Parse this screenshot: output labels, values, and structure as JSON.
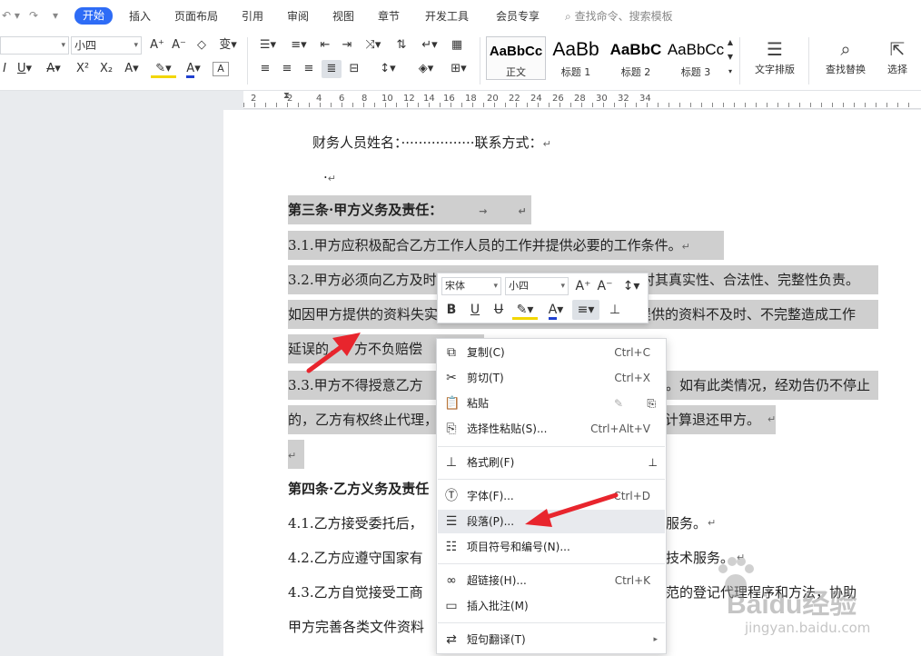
{
  "ribbon_tabs": {
    "home": "开始",
    "insert": "插入",
    "layout": "页面布局",
    "references": "引用",
    "review": "审阅",
    "view": "视图",
    "section": "章节",
    "developer": "开发工具",
    "member": "会员专享",
    "search": "查找命令、搜索模板"
  },
  "ribbon": {
    "font_size": "小四",
    "styles": [
      {
        "sample": "AaBbCc",
        "name": "正文"
      },
      {
        "sample": "AaBb",
        "name": "标题 1"
      },
      {
        "sample": "AaBbC",
        "name": "标题 2"
      },
      {
        "sample": "AaBbCc",
        "name": "标题 3"
      }
    ],
    "layout_btn": "文字排版",
    "find_replace_btn": "查找替换",
    "select_btn": "选择"
  },
  "ruler_labels": [
    "2",
    "2",
    "4",
    "6",
    "8",
    "10",
    "12",
    "14",
    "16",
    "18",
    "20",
    "22",
    "24",
    "26",
    "28",
    "30",
    "32",
    "34"
  ],
  "doc": {
    "line1": "财务人员姓名：·················联系方式：",
    "line2": "·",
    "heading3": "第三条·甲方义务及责任：",
    "p31": "3.1.甲方应积极配合乙方工作人员的工作并提供必要的工作条件。",
    "p32a": "3.2.甲方必须向乙方及时",
    "p32a_end": "对其真实性、合法性、完整性负责。",
    "p32b_start": "如因甲方提供的资料失实",
    "p32b_end": "提供的资料不及时、不完整造成工作",
    "p32c_start": "延误的，",
    "p32c_mid": "方不负赔偿",
    "p33a_start": "3.3.甲方不得授意乙方",
    "p33a_end": "。如有此类情况，经劝告仍不停止",
    "p33b_start": "的，乙方有权终止代理，",
    "p33b_end": "计算退还甲方。",
    "heading4": "第四条·乙方义务及责任",
    "p41_start": "4.1.乙方接受委托后，",
    "p41_end": "服务。",
    "p42_start": "4.2.乙方应遵守国家有",
    "p42_end": "技术服务。",
    "p43_start": "4.3.乙方自觉接受工商",
    "p43_end": "范的登记代理程序和方法，协助",
    "p43b": "甲方完善各类文件资料"
  },
  "minibar": {
    "font": "宋体",
    "size": "小四",
    "bold": "B",
    "underline": "U"
  },
  "context_menu": {
    "copy": "复制(C)",
    "copy_sc": "Ctrl+C",
    "cut": "剪切(T)",
    "cut_sc": "Ctrl+X",
    "paste": "粘贴",
    "paste_special": "选择性粘贴(S)...",
    "paste_special_sc": "Ctrl+Alt+V",
    "format_painter": "格式刷(F)",
    "font": "字体(F)...",
    "font_sc": "Ctrl+D",
    "paragraph": "段落(P)...",
    "bullets": "项目符号和编号(N)...",
    "hyperlink": "超链接(H)...",
    "hyperlink_sc": "Ctrl+K",
    "comment": "插入批注(M)",
    "translate": "短句翻译(T)"
  },
  "watermark": {
    "brand": "Baidu经验",
    "url": "jingyan.baidu.com"
  },
  "colors": {
    "accent": "#2e6cf6",
    "arrow": "#e8252d",
    "selection": "#cfcfcf"
  }
}
